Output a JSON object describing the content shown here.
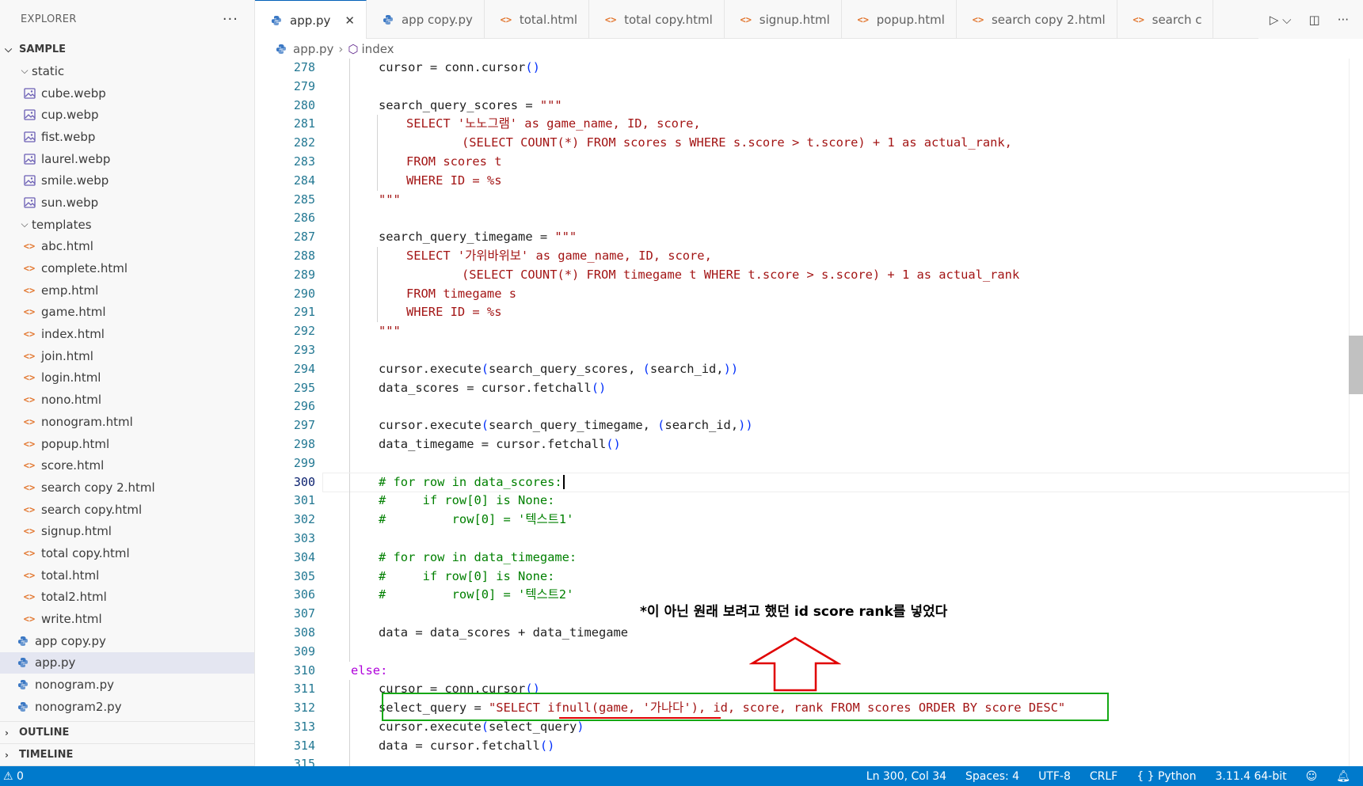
{
  "explorer": {
    "title": "EXPLORER",
    "more": "···",
    "root": "SAMPLE",
    "items": [
      {
        "label": "static",
        "kind": "folder",
        "depth": 1
      },
      {
        "label": "cube.webp",
        "kind": "image",
        "depth": 2
      },
      {
        "label": "cup.webp",
        "kind": "image",
        "depth": 2
      },
      {
        "label": "fist.webp",
        "kind": "image",
        "depth": 2
      },
      {
        "label": "laurel.webp",
        "kind": "image",
        "depth": 2
      },
      {
        "label": "smile.webp",
        "kind": "image",
        "depth": 2
      },
      {
        "label": "sun.webp",
        "kind": "image",
        "depth": 2
      },
      {
        "label": "templates",
        "kind": "folder",
        "depth": 1
      },
      {
        "label": "abc.html",
        "kind": "html",
        "depth": 2
      },
      {
        "label": "complete.html",
        "kind": "html",
        "depth": 2
      },
      {
        "label": "emp.html",
        "kind": "html",
        "depth": 2
      },
      {
        "label": "game.html",
        "kind": "html",
        "depth": 2
      },
      {
        "label": "index.html",
        "kind": "html",
        "depth": 2
      },
      {
        "label": "join.html",
        "kind": "html",
        "depth": 2
      },
      {
        "label": "login.html",
        "kind": "html",
        "depth": 2
      },
      {
        "label": "nono.html",
        "kind": "html",
        "depth": 2
      },
      {
        "label": "nonogram.html",
        "kind": "html",
        "depth": 2
      },
      {
        "label": "popup.html",
        "kind": "html",
        "depth": 2
      },
      {
        "label": "score.html",
        "kind": "html",
        "depth": 2
      },
      {
        "label": "search copy 2.html",
        "kind": "html",
        "depth": 2
      },
      {
        "label": "search copy.html",
        "kind": "html",
        "depth": 2
      },
      {
        "label": "signup.html",
        "kind": "html",
        "depth": 2
      },
      {
        "label": "total copy.html",
        "kind": "html",
        "depth": 2
      },
      {
        "label": "total.html",
        "kind": "html",
        "depth": 2
      },
      {
        "label": "total2.html",
        "kind": "html",
        "depth": 2
      },
      {
        "label": "write.html",
        "kind": "html",
        "depth": 2
      },
      {
        "label": "app copy.py",
        "kind": "python",
        "depth": 1
      },
      {
        "label": "app.py",
        "kind": "python",
        "depth": 1,
        "selected": true
      },
      {
        "label": "nonogram.py",
        "kind": "python",
        "depth": 1
      },
      {
        "label": "nonogram2.py",
        "kind": "python",
        "depth": 1
      }
    ],
    "outline": "OUTLINE",
    "timeline": "TIMELINE"
  },
  "tabs": [
    {
      "label": "app.py",
      "kind": "python",
      "active": true,
      "close": "✕"
    },
    {
      "label": "app copy.py",
      "kind": "python"
    },
    {
      "label": "total.html",
      "kind": "html"
    },
    {
      "label": "total copy.html",
      "kind": "html"
    },
    {
      "label": "signup.html",
      "kind": "html"
    },
    {
      "label": "popup.html",
      "kind": "html"
    },
    {
      "label": "search copy 2.html",
      "kind": "html"
    },
    {
      "label": "search c",
      "kind": "html"
    }
  ],
  "breadcrumb": {
    "file": "app.py",
    "symbol": "index"
  },
  "editor": {
    "current_line": 300,
    "lines": [
      {
        "n": "278",
        "indent": 2,
        "text": "cursor = conn.cursor()"
      },
      {
        "n": "279",
        "indent": 0,
        "text": ""
      },
      {
        "n": "280",
        "indent": 2,
        "text": "search_query_scores = \"\"\""
      },
      {
        "n": "281",
        "indent": 3,
        "text": "SELECT '노노그램' as game_name, ID, score,",
        "cls": "t-str"
      },
      {
        "n": "282",
        "indent": 5,
        "text": "(SELECT COUNT(*) FROM scores s WHERE s.score > t.score) + 1 as actual_rank,",
        "cls": "t-str"
      },
      {
        "n": "283",
        "indent": 3,
        "text": "FROM scores t",
        "cls": "t-str"
      },
      {
        "n": "284",
        "indent": 3,
        "text": "WHERE ID = %s",
        "cls": "t-str"
      },
      {
        "n": "285",
        "indent": 2,
        "text": "\"\"\"",
        "cls": "t-str"
      },
      {
        "n": "286",
        "indent": 0,
        "text": ""
      },
      {
        "n": "287",
        "indent": 2,
        "text": "search_query_timegame = \"\"\""
      },
      {
        "n": "288",
        "indent": 3,
        "text": "SELECT '가위바위보' as game_name, ID, score,",
        "cls": "t-str"
      },
      {
        "n": "289",
        "indent": 5,
        "text": "(SELECT COUNT(*) FROM timegame t WHERE t.score > s.score) + 1 as actual_rank",
        "cls": "t-str"
      },
      {
        "n": "290",
        "indent": 3,
        "text": "FROM timegame s",
        "cls": "t-str"
      },
      {
        "n": "291",
        "indent": 3,
        "text": "WHERE ID = %s",
        "cls": "t-str"
      },
      {
        "n": "292",
        "indent": 2,
        "text": "\"\"\"",
        "cls": "t-str"
      },
      {
        "n": "293",
        "indent": 0,
        "text": ""
      },
      {
        "n": "294",
        "indent": 2,
        "text": "cursor.execute(search_query_scores, (search_id,))"
      },
      {
        "n": "295",
        "indent": 2,
        "text": "data_scores = cursor.fetchall()"
      },
      {
        "n": "296",
        "indent": 0,
        "text": ""
      },
      {
        "n": "297",
        "indent": 2,
        "text": "cursor.execute(search_query_timegame, (search_id,))"
      },
      {
        "n": "298",
        "indent": 2,
        "text": "data_timegame = cursor.fetchall()"
      },
      {
        "n": "299",
        "indent": 0,
        "text": ""
      },
      {
        "n": "300",
        "indent": 2,
        "text": "# for row in data_scores:",
        "cls": "t-com",
        "caret": true
      },
      {
        "n": "301",
        "indent": 2,
        "text": "#     if row[0] is None:",
        "cls": "t-com"
      },
      {
        "n": "302",
        "indent": 2,
        "text": "#         row[0] = '텍스트1'",
        "cls": "t-com"
      },
      {
        "n": "303",
        "indent": 0,
        "text": ""
      },
      {
        "n": "304",
        "indent": 2,
        "text": "# for row in data_timegame:",
        "cls": "t-com"
      },
      {
        "n": "305",
        "indent": 2,
        "text": "#     if row[0] is None:",
        "cls": "t-com"
      },
      {
        "n": "306",
        "indent": 2,
        "text": "#         row[0] = '텍스트2'",
        "cls": "t-com"
      },
      {
        "n": "307",
        "indent": 0,
        "text": ""
      },
      {
        "n": "308",
        "indent": 2,
        "text": "data = data_scores + data_timegame"
      },
      {
        "n": "309",
        "indent": 0,
        "text": ""
      },
      {
        "n": "310",
        "indent": 1,
        "text": "else:",
        "cls": "t-kw2"
      },
      {
        "n": "311",
        "indent": 2,
        "text": "cursor = conn.cursor()"
      },
      {
        "n": "312",
        "indent": 2,
        "text": "select_query = \"SELECT ifnull(game, '가나다'), id, score, rank FROM scores ORDER BY score DESC\"",
        "split": true
      },
      {
        "n": "313",
        "indent": 2,
        "text": "cursor.execute(select_query)"
      },
      {
        "n": "314",
        "indent": 2,
        "text": "data = cursor.fetchall()"
      },
      {
        "n": "315",
        "indent": 0,
        "text": ""
      }
    ]
  },
  "annotation": {
    "text": "*이 아닌 원래 보려고 했던 id score rank를 넣었다"
  },
  "status": {
    "problems": "⚠ 0",
    "position": "Ln 300, Col 34",
    "spaces": "Spaces: 4",
    "encoding": "UTF-8",
    "eol": "CRLF",
    "language": "{ } Python",
    "interpreter": "3.11.4 64-bit"
  },
  "colors": {
    "statusbar": "#007acc",
    "annotation_box": "#14a814",
    "annotation_arrow": "#e00000"
  }
}
